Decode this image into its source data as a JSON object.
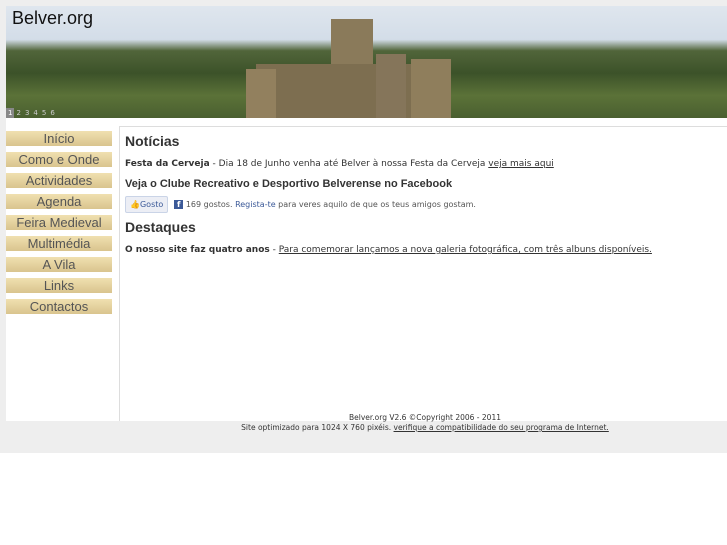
{
  "header": {
    "logo": "Belver.org",
    "slides": [
      "1",
      "2",
      "3",
      "4",
      "5",
      "6"
    ]
  },
  "nav": [
    "Início",
    "Como e Onde",
    "Actividades",
    "Agenda",
    "Feira Medieval",
    "Multimédia",
    "A Vila",
    "Links",
    "Contactos"
  ],
  "news": {
    "title": "Notícias",
    "item_title": "Festa da Cerveja",
    "item_text": " - Dia 18 de Junho venha até Belver à nossa Festa da Cerveja ",
    "item_link": "veja mais aqui",
    "facebook_heading": "Veja o Clube Recreativo e Desportivo Belverense no Facebook",
    "like_label": "Gosto",
    "likes": "169 gostos.",
    "register": "Regista-te",
    "like_text": " para veres aquilo de que os teus amigos gostam."
  },
  "highlights": {
    "title": "Destaques",
    "item_title": "O nosso site faz quatro anos",
    "sep": " - ",
    "item_link": "Para comemorar lançamos a nova galeria fotográfica, com três albuns disponíveis."
  },
  "footer": {
    "copyright": "Belver.org V2.6 ©Copyright 2006 - 2011",
    "optimized": "Site optimizado para 1024 X 760 pixéis. ",
    "compat_link": "verifique a compatibilidade do seu programa de Internet."
  }
}
